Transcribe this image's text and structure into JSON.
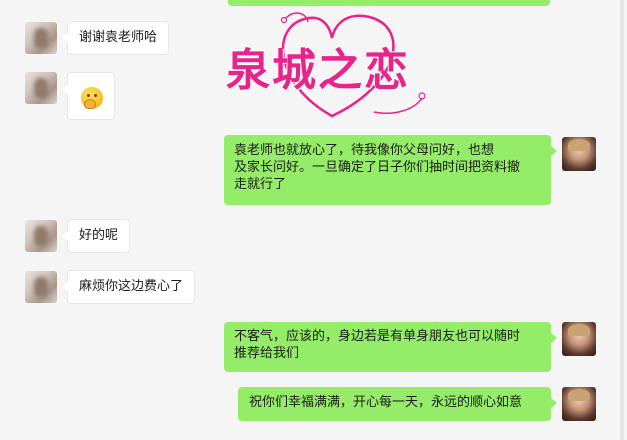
{
  "watermark": {
    "text": "泉城之恋",
    "color": "#e8238a"
  },
  "colors": {
    "outgoing_bubble": "#95ec69",
    "incoming_bubble": "#ffffff",
    "background": "#f5f5f5"
  },
  "messages": [
    {
      "side": "in",
      "text": "谢谢袁老师哈"
    },
    {
      "side": "in",
      "icon": "thinking-emoji-icon"
    },
    {
      "side": "out",
      "text": "袁老师也就放心了，待我像你父母问好，也想 … 及家长问好。一旦确定了日子你们抽时间把资料撤走就行了",
      "line1": "袁老师也就放心了，待我像你父母问好，也想",
      "line2": "及家长问好。一旦确定了日子你们抽时间把资料撤",
      "line3": "走就行了"
    },
    {
      "side": "in",
      "text": "好的呢"
    },
    {
      "side": "in",
      "text": "麻烦你这边费心了"
    },
    {
      "side": "out",
      "line1": "不客气，应该的，身边若是有单身朋友也可以随时",
      "line2": "推荐给我们"
    },
    {
      "side": "out",
      "text": "祝你们幸福满满，开心每一天，永远的顺心如意"
    }
  ]
}
